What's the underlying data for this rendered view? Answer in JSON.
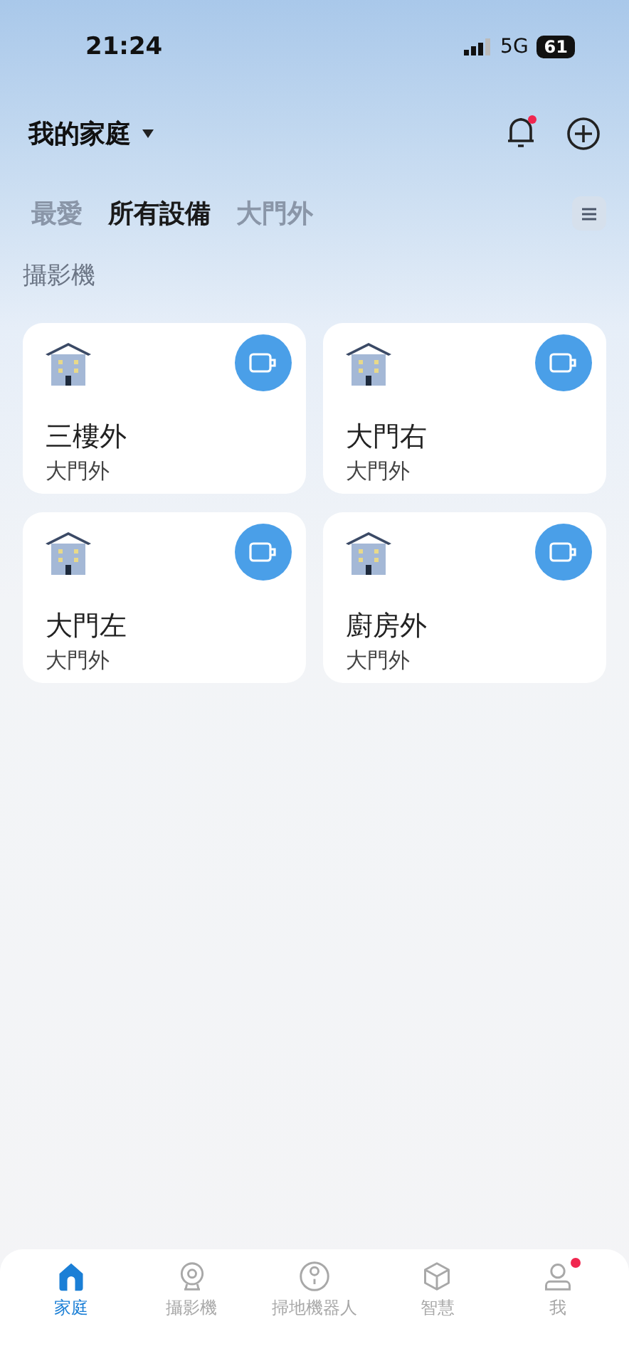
{
  "status_bar": {
    "time": "21:24",
    "network": "5G",
    "battery": "61"
  },
  "header": {
    "home_name": "我的家庭",
    "notifications": {
      "badge": true
    }
  },
  "tabs": [
    {
      "label": "最愛",
      "selected": false
    },
    {
      "label": "所有設備",
      "selected": true
    },
    {
      "label": "大門外",
      "selected": false
    }
  ],
  "section": {
    "title": "攝影機"
  },
  "devices": [
    {
      "name": "三樓外",
      "room": "大門外"
    },
    {
      "name": "大門右",
      "room": "大門外"
    },
    {
      "name": "大門左",
      "room": "大門外"
    },
    {
      "name": "廚房外",
      "room": "大門外"
    }
  ],
  "bottom_nav": [
    {
      "kind": "home",
      "label": "家庭",
      "selected": true,
      "badge": false
    },
    {
      "kind": "camera",
      "label": "攝影機",
      "selected": false,
      "badge": false
    },
    {
      "kind": "robot",
      "label": "掃地機器人",
      "selected": false,
      "badge": false
    },
    {
      "kind": "smart",
      "label": "智慧",
      "selected": false,
      "badge": false
    },
    {
      "kind": "me",
      "label": "我",
      "selected": false,
      "badge": true
    }
  ]
}
